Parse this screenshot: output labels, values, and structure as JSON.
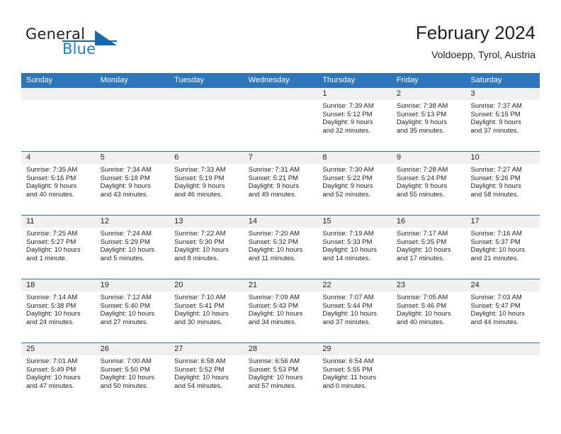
{
  "brand": {
    "word_one": "General",
    "word_two": "Blue",
    "triangle_icon": "triangle-icon",
    "colors": {
      "dark": "#231f20",
      "blue": "#1b7fd4",
      "deep_blue": "#1667ad"
    }
  },
  "header": {
    "title": "February 2024",
    "location": "Voldoepp, Tyrol, Austria"
  },
  "theme": {
    "header_blue": "#2d76bb",
    "day_band_gray": "#f0f0f0",
    "cell_white": "#ffffff",
    "text": "#231f20"
  },
  "weekdays": [
    "Sunday",
    "Monday",
    "Tuesday",
    "Wednesday",
    "Thursday",
    "Friday",
    "Saturday"
  ],
  "weeks": [
    [
      {
        "day": "",
        "sunrise": "",
        "sunset": "",
        "daylight_line1": "",
        "daylight_line2": "",
        "empty": true
      },
      {
        "day": "",
        "sunrise": "",
        "sunset": "",
        "daylight_line1": "",
        "daylight_line2": "",
        "empty": true
      },
      {
        "day": "",
        "sunrise": "",
        "sunset": "",
        "daylight_line1": "",
        "daylight_line2": "",
        "empty": true
      },
      {
        "day": "",
        "sunrise": "",
        "sunset": "",
        "daylight_line1": "",
        "daylight_line2": "",
        "empty": true
      },
      {
        "day": "1",
        "sunrise": "Sunrise: 7:39 AM",
        "sunset": "Sunset: 5:12 PM",
        "daylight_line1": "Daylight: 9 hours",
        "daylight_line2": "and 32 minutes.",
        "empty": false
      },
      {
        "day": "2",
        "sunrise": "Sunrise: 7:38 AM",
        "sunset": "Sunset: 5:13 PM",
        "daylight_line1": "Daylight: 9 hours",
        "daylight_line2": "and 35 minutes.",
        "empty": false
      },
      {
        "day": "3",
        "sunrise": "Sunrise: 7:37 AM",
        "sunset": "Sunset: 5:15 PM",
        "daylight_line1": "Daylight: 9 hours",
        "daylight_line2": "and 37 minutes.",
        "empty": false
      }
    ],
    [
      {
        "day": "4",
        "sunrise": "Sunrise: 7:35 AM",
        "sunset": "Sunset: 5:16 PM",
        "daylight_line1": "Daylight: 9 hours",
        "daylight_line2": "and 40 minutes.",
        "empty": false
      },
      {
        "day": "5",
        "sunrise": "Sunrise: 7:34 AM",
        "sunset": "Sunset: 5:18 PM",
        "daylight_line1": "Daylight: 9 hours",
        "daylight_line2": "and 43 minutes.",
        "empty": false
      },
      {
        "day": "6",
        "sunrise": "Sunrise: 7:33 AM",
        "sunset": "Sunset: 5:19 PM",
        "daylight_line1": "Daylight: 9 hours",
        "daylight_line2": "and 46 minutes.",
        "empty": false
      },
      {
        "day": "7",
        "sunrise": "Sunrise: 7:31 AM",
        "sunset": "Sunset: 5:21 PM",
        "daylight_line1": "Daylight: 9 hours",
        "daylight_line2": "and 49 minutes.",
        "empty": false
      },
      {
        "day": "8",
        "sunrise": "Sunrise: 7:30 AM",
        "sunset": "Sunset: 5:22 PM",
        "daylight_line1": "Daylight: 9 hours",
        "daylight_line2": "and 52 minutes.",
        "empty": false
      },
      {
        "day": "9",
        "sunrise": "Sunrise: 7:28 AM",
        "sunset": "Sunset: 5:24 PM",
        "daylight_line1": "Daylight: 9 hours",
        "daylight_line2": "and 55 minutes.",
        "empty": false
      },
      {
        "day": "10",
        "sunrise": "Sunrise: 7:27 AM",
        "sunset": "Sunset: 5:26 PM",
        "daylight_line1": "Daylight: 9 hours",
        "daylight_line2": "and 58 minutes.",
        "empty": false
      }
    ],
    [
      {
        "day": "11",
        "sunrise": "Sunrise: 7:25 AM",
        "sunset": "Sunset: 5:27 PM",
        "daylight_line1": "Daylight: 10 hours",
        "daylight_line2": "and 1 minute.",
        "empty": false
      },
      {
        "day": "12",
        "sunrise": "Sunrise: 7:24 AM",
        "sunset": "Sunset: 5:29 PM",
        "daylight_line1": "Daylight: 10 hours",
        "daylight_line2": "and 5 minutes.",
        "empty": false
      },
      {
        "day": "13",
        "sunrise": "Sunrise: 7:22 AM",
        "sunset": "Sunset: 5:30 PM",
        "daylight_line1": "Daylight: 10 hours",
        "daylight_line2": "and 8 minutes.",
        "empty": false
      },
      {
        "day": "14",
        "sunrise": "Sunrise: 7:20 AM",
        "sunset": "Sunset: 5:32 PM",
        "daylight_line1": "Daylight: 10 hours",
        "daylight_line2": "and 11 minutes.",
        "empty": false
      },
      {
        "day": "15",
        "sunrise": "Sunrise: 7:19 AM",
        "sunset": "Sunset: 5:33 PM",
        "daylight_line1": "Daylight: 10 hours",
        "daylight_line2": "and 14 minutes.",
        "empty": false
      },
      {
        "day": "16",
        "sunrise": "Sunrise: 7:17 AM",
        "sunset": "Sunset: 5:35 PM",
        "daylight_line1": "Daylight: 10 hours",
        "daylight_line2": "and 17 minutes.",
        "empty": false
      },
      {
        "day": "17",
        "sunrise": "Sunrise: 7:16 AM",
        "sunset": "Sunset: 5:37 PM",
        "daylight_line1": "Daylight: 10 hours",
        "daylight_line2": "and 21 minutes.",
        "empty": false
      }
    ],
    [
      {
        "day": "18",
        "sunrise": "Sunrise: 7:14 AM",
        "sunset": "Sunset: 5:38 PM",
        "daylight_line1": "Daylight: 10 hours",
        "daylight_line2": "and 24 minutes.",
        "empty": false
      },
      {
        "day": "19",
        "sunrise": "Sunrise: 7:12 AM",
        "sunset": "Sunset: 5:40 PM",
        "daylight_line1": "Daylight: 10 hours",
        "daylight_line2": "and 27 minutes.",
        "empty": false
      },
      {
        "day": "20",
        "sunrise": "Sunrise: 7:10 AM",
        "sunset": "Sunset: 5:41 PM",
        "daylight_line1": "Daylight: 10 hours",
        "daylight_line2": "and 30 minutes.",
        "empty": false
      },
      {
        "day": "21",
        "sunrise": "Sunrise: 7:09 AM",
        "sunset": "Sunset: 5:43 PM",
        "daylight_line1": "Daylight: 10 hours",
        "daylight_line2": "and 34 minutes.",
        "empty": false
      },
      {
        "day": "22",
        "sunrise": "Sunrise: 7:07 AM",
        "sunset": "Sunset: 5:44 PM",
        "daylight_line1": "Daylight: 10 hours",
        "daylight_line2": "and 37 minutes.",
        "empty": false
      },
      {
        "day": "23",
        "sunrise": "Sunrise: 7:05 AM",
        "sunset": "Sunset: 5:46 PM",
        "daylight_line1": "Daylight: 10 hours",
        "daylight_line2": "and 40 minutes.",
        "empty": false
      },
      {
        "day": "24",
        "sunrise": "Sunrise: 7:03 AM",
        "sunset": "Sunset: 5:47 PM",
        "daylight_line1": "Daylight: 10 hours",
        "daylight_line2": "and 44 minutes.",
        "empty": false
      }
    ],
    [
      {
        "day": "25",
        "sunrise": "Sunrise: 7:01 AM",
        "sunset": "Sunset: 5:49 PM",
        "daylight_line1": "Daylight: 10 hours",
        "daylight_line2": "and 47 minutes.",
        "empty": false
      },
      {
        "day": "26",
        "sunrise": "Sunrise: 7:00 AM",
        "sunset": "Sunset: 5:50 PM",
        "daylight_line1": "Daylight: 10 hours",
        "daylight_line2": "and 50 minutes.",
        "empty": false
      },
      {
        "day": "27",
        "sunrise": "Sunrise: 6:58 AM",
        "sunset": "Sunset: 5:52 PM",
        "daylight_line1": "Daylight: 10 hours",
        "daylight_line2": "and 54 minutes.",
        "empty": false
      },
      {
        "day": "28",
        "sunrise": "Sunrise: 6:56 AM",
        "sunset": "Sunset: 5:53 PM",
        "daylight_line1": "Daylight: 10 hours",
        "daylight_line2": "and 57 minutes.",
        "empty": false
      },
      {
        "day": "29",
        "sunrise": "Sunrise: 6:54 AM",
        "sunset": "Sunset: 5:55 PM",
        "daylight_line1": "Daylight: 11 hours",
        "daylight_line2": "and 0 minutes.",
        "empty": false
      },
      {
        "day": "",
        "sunrise": "",
        "sunset": "",
        "daylight_line1": "",
        "daylight_line2": "",
        "empty": true
      },
      {
        "day": "",
        "sunrise": "",
        "sunset": "",
        "daylight_line1": "",
        "daylight_line2": "",
        "empty": true
      }
    ]
  ]
}
